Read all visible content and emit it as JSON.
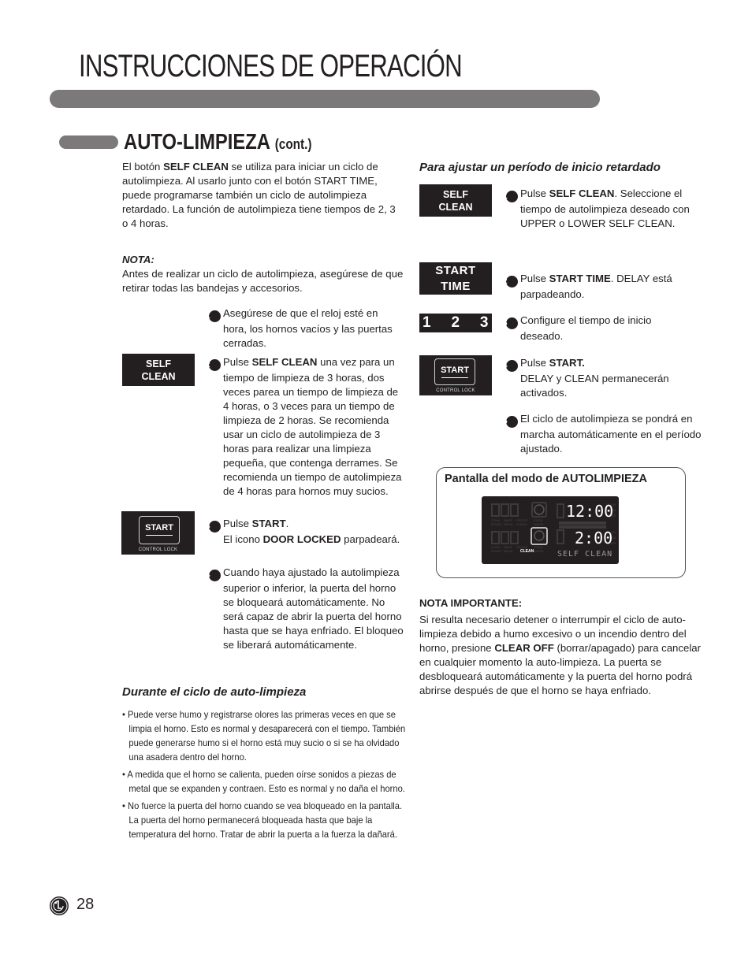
{
  "header": {
    "title": "INSTRUCCIONES DE OPERACIÓN"
  },
  "section": {
    "title": "AUTO-LIMPIEZA",
    "title_suffix": "(cont.)"
  },
  "intro": {
    "p1": "El botón ",
    "p1_bold": "SELF CLEAN",
    "p2": " se utiliza para iniciar un ciclo de autolimpieza. Al usarlo junto con el botón START TIME, puede programarse también un ciclo de autolimpieza retardado. La función de autolimpieza tiene tiempos de 2, 3 o 4 horas."
  },
  "nota": {
    "label": "NOTA:",
    "text": "Antes de realizar un ciclo de autolimpieza, asegúrese de que retirar todas las bandejas y accesorios."
  },
  "left_steps": [
    {
      "num": "1",
      "pre": "Asegúrese de que el reloj esté en hora, los hornos vacíos y las puertas cerradas.",
      "bold": "",
      "post": ""
    },
    {
      "num": "2",
      "pre": "Pulse ",
      "bold": "SELF CLEAN",
      "post": " una vez para un tiempo de limpieza de 3 horas, dos veces parea un tiempo de limpieza de 4 horas, o 3 veces para un tiempo de limpieza de 2 horas. Se recomienda usar un ciclo de autolimpieza de 3 horas para realizar una limpieza pequeña, que contenga derrames. Se recomienda un tiempo de autolimpieza de 4 horas para hornos muy sucios."
    },
    {
      "num": "3",
      "pre": "Pulse ",
      "bold": "START",
      "post": ".",
      "line2_pre": "El icono ",
      "line2_bold": "DOOR LOCKED",
      "line2_post": " parpadeará."
    },
    {
      "num": "4",
      "pre": "Cuando haya ajustado la autolimpieza superior o inferior, la puerta del horno se bloqueará automáticamente. No será capaz de abrir la puerta del horno hasta que se haya enfriado. El bloqueo se liberará automáticamente.",
      "bold": "",
      "post": ""
    }
  ],
  "keys": {
    "self_clean_line1": "SELF",
    "self_clean_line2": "CLEAN",
    "start": "START",
    "control_lock": "CONTROL LOCK",
    "start_time_line1": "START",
    "start_time_line2": "TIME",
    "numbers": [
      "1",
      "2",
      "3"
    ]
  },
  "during": {
    "heading": "Durante el ciclo de auto-limpieza",
    "bullets": [
      "Puede verse humo y registrarse olores las primeras veces en que se limpia el horno. Esto es normal y desaparecerá con el tiempo. También puede generarse humo si el horno está muy sucio o si se ha olvidado una asadera dentro del horno.",
      "A medida que el horno se calienta, pueden oírse sonidos a piezas de metal que se expanden y contraen. Esto es normal y no daña el horno.",
      "No fuerce la puerta del horno cuando se vea bloqueado en la pantalla. La puerta del horno permanecerá bloqueada hasta que baje la temperatura del horno. Tratar de abrir la puerta a la fuerza la dañará."
    ],
    "bullet_glyph": "•"
  },
  "delay": {
    "heading": "Para ajustar un período de inicio retardado",
    "steps": [
      {
        "num": "1",
        "pre": "Pulse ",
        "bold": "SELF CLEAN",
        "post": ". Seleccione el tiempo de autolimpieza deseado con UPPER o LOWER SELF CLEAN."
      },
      {
        "num": "2",
        "pre": "Pulse ",
        "bold": "START TIME",
        "post": ". DELAY está parpadeando."
      },
      {
        "num": "3",
        "pre": "Configure el tiempo de inicio deseado.",
        "bold": "",
        "post": ""
      },
      {
        "num": "4",
        "pre": "Pulse ",
        "bold": "START.",
        "post": "",
        "line2": "DELAY y CLEAN permanecerán activados."
      },
      {
        "num": "5",
        "pre": "El ciclo de autolimpieza se pondrá en marcha automáticamente en el período ajustado.",
        "bold": "",
        "post": ""
      }
    ]
  },
  "display": {
    "caption": "Pantalla del modo de AUTOLIMPIEZA",
    "upper_time": "12:00",
    "lower_time": "2:00",
    "message": "SELF CLEAN",
    "clean_label": "CLEAN",
    "mode_labels_top": [
      "CONV",
      "BAKE",
      "PROOF",
      "COOK"
    ],
    "mode_labels_bottom": [
      "ROAST",
      "BROIL",
      "CLEAN",
      "WARM"
    ],
    "side_labels": [
      "DELAY",
      "TIMED",
      "TIMER"
    ]
  },
  "important": {
    "label": "NOTA IMPORTANTE:",
    "pre": "Si resulta necesario detener o interrumpir el ciclo de auto-limpieza debido a humo excesivo o un incendio dentro del horno, presione ",
    "bold": "CLEAR OFF",
    "post": " (borrar/apagado) para cancelar en cualquier momento la auto-limpieza. La puerta se desbloqueará automáticamente y la puerta del horno podrá abrirse después de que el horno se haya enfriado."
  },
  "footer": {
    "logo": "LG",
    "page_number": "28"
  }
}
